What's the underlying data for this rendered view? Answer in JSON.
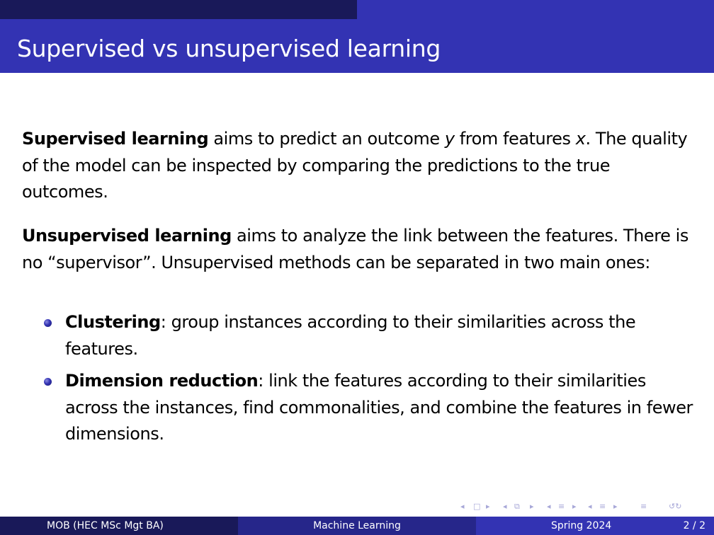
{
  "slide": {
    "title": "Supervised vs unsupervised learning"
  },
  "body": {
    "p1": {
      "term": "Supervised learning",
      "t1": " aims to predict an outcome ",
      "var_y": "y",
      "t2": " from features ",
      "var_x": "x",
      "t3": ". The quality of the model can be inspected by comparing the predictions to the true outcomes."
    },
    "p2": {
      "term": "Unsupervised learning",
      "text": " aims to analyze the link between the features. There is no “supervisor”. Unsupervised methods can be separated in two main ones:"
    },
    "bullets": [
      {
        "term": "Clustering",
        "text": ": group instances according to their similarities across the features."
      },
      {
        "term": "Dimension reduction",
        "text": ": link the features according to their similarities across the instances, find commonalities, and combine the features in fewer dimensions."
      }
    ]
  },
  "nav": {
    "frame_prev": "◂",
    "frame_icon": "□",
    "frame_next": "▸",
    "sub_prev": "◂",
    "sub_icon": "⧉",
    "sub_next": "▸",
    "sec_prev": "◂",
    "sec_icon": "≡",
    "sec_next": "▸",
    "part_prev": "◂",
    "part_icon": "≡",
    "part_next": "▸",
    "toc_icon": "≡",
    "search_icon": "↺↻"
  },
  "footer": {
    "author": "MOB  (HEC MSc Mgt BA)",
    "title": "Machine Learning",
    "date": "Spring 2024",
    "page": "2 / 2"
  }
}
